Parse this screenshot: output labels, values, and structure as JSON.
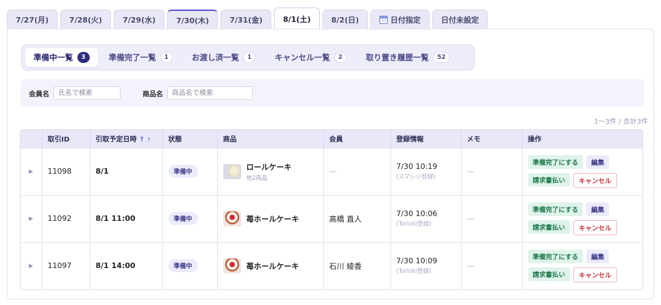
{
  "date_tabs": [
    {
      "label": "7/27(月)"
    },
    {
      "label": "7/28(火)"
    },
    {
      "label": "7/29(水)"
    },
    {
      "label": "7/30(木)"
    },
    {
      "label": "7/31(金)"
    },
    {
      "label": "8/1(土)"
    },
    {
      "label": "8/2(日)"
    },
    {
      "label": "日付指定",
      "icon": "calendar-icon"
    },
    {
      "label": "日付未設定"
    }
  ],
  "active_date_tab": "8/1(土)",
  "status_tabs": [
    {
      "label": "準備中一覧",
      "count": "3"
    },
    {
      "label": "準備完了一覧",
      "count": "1"
    },
    {
      "label": "お渡し済一覧",
      "count": "1"
    },
    {
      "label": "キャンセル一覧",
      "count": "2"
    },
    {
      "label": "取り置き履歴一覧",
      "count": "52"
    }
  ],
  "search": {
    "member_label": "会員名",
    "member_placeholder": "氏名で検索",
    "product_label": "商品名",
    "product_placeholder": "商品名で検索"
  },
  "result_count": "1〜3件 / 合計3件",
  "table": {
    "headers": {
      "id": "取引ID",
      "pickup": "引取予定日時",
      "pickup_sort": "↑",
      "pickup_help": "?",
      "state": "状態",
      "product": "商品",
      "member": "会員",
      "registered": "登録情報",
      "memo": "メモ",
      "ops": "操作"
    },
    "rows": [
      {
        "expand": "▶",
        "id": "11098",
        "pickup": "8/1",
        "state": "準備中",
        "product": "ロールケーキ",
        "product_sub": "他2商品",
        "member": "—",
        "reg_time": "7/30 10:19",
        "reg_src": "(スマレジ登録)",
        "memo": "—"
      },
      {
        "expand": "▶",
        "id": "11092",
        "pickup": "8/1 11:00",
        "state": "準備中",
        "product": "苺ホールケーキ",
        "product_sub": "",
        "member": "高橋 直人",
        "reg_time": "7/30 10:06",
        "reg_src": "(Torioki登録)",
        "memo": "—"
      },
      {
        "expand": "▶",
        "id": "11097",
        "pickup": "8/1 14:00",
        "state": "準備中",
        "product": "苺ホールケーキ",
        "product_sub": "",
        "member": "石川 綾香",
        "reg_time": "7/30 10:09",
        "reg_src": "(Torioki登録)",
        "memo": "—"
      }
    ],
    "buttons": {
      "ready": "準備完了にする",
      "edit": "編集",
      "invoice": "請求書払い",
      "cancel": "キャンセル"
    }
  }
}
